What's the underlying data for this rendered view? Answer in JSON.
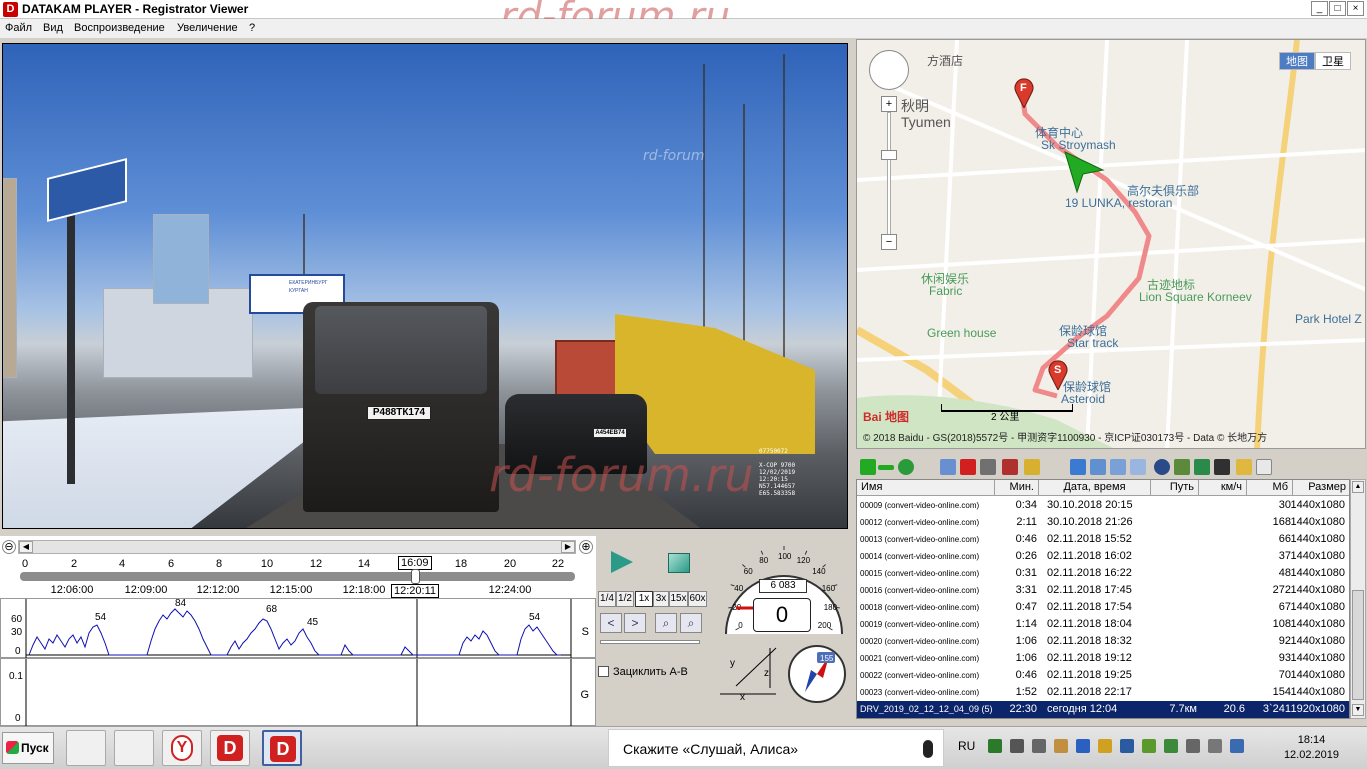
{
  "window": {
    "title": "DATAKAM PLAYER - Registrator Viewer",
    "app_icon": "D",
    "minimize": "_",
    "maximize": "□",
    "close": "×",
    "watermark": "rd-forum.ru"
  },
  "menu": {
    "items": [
      "Файл",
      "Вид",
      "Воспроизведение",
      "Увеличение",
      "?"
    ]
  },
  "video": {
    "plate_van": "Р488ТК174",
    "plate_car": "А454ЕВ74",
    "sign_line1": "ЕКАТЕРИНБУРГ",
    "sign_line2": "КУРГАН",
    "overlay_lines": [
      "07750072",
      "X-COP 9700",
      "12/02/2019",
      "12:20:15",
      "N57.144657",
      "E65.583358"
    ],
    "watermark_small": "rd-forum"
  },
  "timeline": {
    "hour_ticks": [
      "0",
      "2",
      "4",
      "6",
      "8",
      "10",
      "12",
      "14",
      "16:09",
      "18",
      "20",
      "22"
    ],
    "time_labels": [
      "12:06:00",
      "12:09:00",
      "12:12:00",
      "12:15:00",
      "12:18:00",
      "12:20:11",
      "12:24:00"
    ],
    "zoom_out_icon": "⊖",
    "zoom_in_icon": "⊕"
  },
  "speed_graph": {
    "y_ticks": [
      "60",
      "30",
      "0"
    ],
    "side_label": "S",
    "peak_labels": [
      "54",
      "84",
      "68",
      "45",
      "54"
    ]
  },
  "g_graph": {
    "y_ticks": [
      "0.1",
      "0"
    ],
    "side_label": "G"
  },
  "controls": {
    "speeds": [
      "1/4",
      "1/2",
      "1x",
      "3x",
      "15x",
      "60x"
    ],
    "active_speed": "1x",
    "loop_label": "Зациклить А-В"
  },
  "gauge": {
    "speed": "0",
    "odometer": "6 083",
    "scale": [
      "0",
      "20",
      "40",
      "60",
      "80",
      "100",
      "120",
      "140",
      "160",
      "180",
      "200"
    ],
    "compass_label": "155",
    "axes": [
      "y",
      "z",
      "x"
    ]
  },
  "map": {
    "types": [
      "地图",
      "卫星"
    ],
    "active_type": "地图",
    "labels": [
      {
        "text": "方酒店",
        "style": "plain"
      },
      {
        "text": "秋明",
        "style": "plain"
      },
      {
        "text": "Tyumen",
        "style": "plain"
      },
      {
        "text": "体育中心",
        "style": "blue"
      },
      {
        "text": "Sk Stroymash",
        "style": "blue"
      },
      {
        "text": "高尔夫俱乐部",
        "style": "blue"
      },
      {
        "text": "19 LUNKA, restoran",
        "style": "blue"
      },
      {
        "text": "休闲娱乐",
        "style": "green"
      },
      {
        "text": "Fabric",
        "style": "green"
      },
      {
        "text": "古迹地标",
        "style": "green"
      },
      {
        "text": "Lion Square Korneev",
        "style": "green"
      },
      {
        "text": "Green house",
        "style": "green"
      },
      {
        "text": "保龄球馆",
        "style": "blue"
      },
      {
        "text": "Star track",
        "style": "blue"
      },
      {
        "text": "保龄球馆",
        "style": "blue"
      },
      {
        "text": "Asteroid",
        "style": "blue"
      },
      {
        "text": "Park Hotel Z",
        "style": "blue"
      }
    ],
    "marker_finish": "F",
    "marker_start": "S",
    "scale_text": "2 公里",
    "baidu_logo": "Bai 地图",
    "copyright": "© 2018 Baidu - GS(2018)5572号 - 甲测资字1100930 - 京ICP证030173号 - Data © 长地万方"
  },
  "file_table": {
    "headers": [
      "Имя",
      "Мин.",
      "Дата, время",
      "Путь",
      "км/ч",
      "Мб",
      "Размер"
    ],
    "rows": [
      {
        "name": "00009 (convert-video-online.com)",
        "min": "0:34",
        "dt": "30.10.2018 20:15",
        "path": "",
        "kmh": "",
        "mb": "30",
        "size": "1440x1080"
      },
      {
        "name": "00012 (convert-video-online.com)",
        "min": "2:11",
        "dt": "30.10.2018 21:26",
        "path": "",
        "kmh": "",
        "mb": "168",
        "size": "1440x1080"
      },
      {
        "name": "00013 (convert-video-online.com)",
        "min": "0:46",
        "dt": "02.11.2018 15:52",
        "path": "",
        "kmh": "",
        "mb": "66",
        "size": "1440x1080"
      },
      {
        "name": "00014 (convert-video-online.com)",
        "min": "0:26",
        "dt": "02.11.2018 16:02",
        "path": "",
        "kmh": "",
        "mb": "37",
        "size": "1440x1080"
      },
      {
        "name": "00015 (convert-video-online.com)",
        "min": "0:31",
        "dt": "02.11.2018 16:22",
        "path": "",
        "kmh": "",
        "mb": "48",
        "size": "1440x1080"
      },
      {
        "name": "00016 (convert-video-online.com)",
        "min": "3:31",
        "dt": "02.11.2018 17:45",
        "path": "",
        "kmh": "",
        "mb": "272",
        "size": "1440x1080"
      },
      {
        "name": "00018 (convert-video-online.com)",
        "min": "0:47",
        "dt": "02.11.2018 17:54",
        "path": "",
        "kmh": "",
        "mb": "67",
        "size": "1440x1080"
      },
      {
        "name": "00019 (convert-video-online.com)",
        "min": "1:14",
        "dt": "02.11.2018 18:04",
        "path": "",
        "kmh": "",
        "mb": "108",
        "size": "1440x1080"
      },
      {
        "name": "00020 (convert-video-online.com)",
        "min": "1:06",
        "dt": "02.11.2018 18:32",
        "path": "",
        "kmh": "",
        "mb": "92",
        "size": "1440x1080"
      },
      {
        "name": "00021 (convert-video-online.com)",
        "min": "1:06",
        "dt": "02.11.2018 19:12",
        "path": "",
        "kmh": "",
        "mb": "93",
        "size": "1440x1080"
      },
      {
        "name": "00022 (convert-video-online.com)",
        "min": "0:46",
        "dt": "02.11.2018 19:25",
        "path": "",
        "kmh": "",
        "mb": "70",
        "size": "1440x1080"
      },
      {
        "name": "00023 (convert-video-online.com)",
        "min": "1:52",
        "dt": "02.11.2018 22:17",
        "path": "",
        "kmh": "",
        "mb": "154",
        "size": "1440x1080"
      },
      {
        "name": "DRV_2019_02_12_12_04_09 (5)",
        "min": "22:30",
        "dt": "сегодня 12:04",
        "path": "7.7км",
        "kmh": "20.6",
        "mb": "3`241",
        "size": "1920x1080",
        "selected": true
      }
    ]
  },
  "taskbar": {
    "start_label": "Пуск",
    "alisa_text": "Скажите «Слушай, Алиса»",
    "lang": "RU",
    "time": "18:14",
    "date": "12.02.2019"
  },
  "colors": {
    "route": "#f08a8a",
    "selection": "#0b246a",
    "graph_line": "#1010b0",
    "accent_play": "#2b9a86"
  }
}
